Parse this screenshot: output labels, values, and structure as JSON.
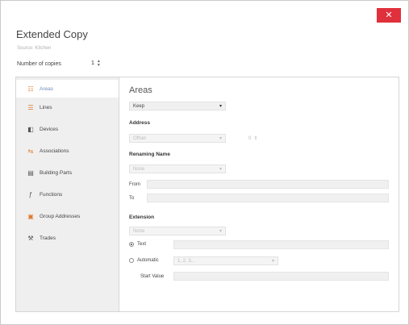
{
  "window": {
    "title": "Extended Copy",
    "subtitle": "Source: Kitchen",
    "close_label": "✕"
  },
  "copies": {
    "label": "Number of copies",
    "value": "1"
  },
  "nav": {
    "items": [
      {
        "label": "Areas",
        "icon": "areas-icon",
        "selected": true
      },
      {
        "label": "Lines",
        "icon": "lines-icon",
        "selected": false
      },
      {
        "label": "Devices",
        "icon": "devices-icon",
        "selected": false
      },
      {
        "label": "Associations",
        "icon": "associations-icon",
        "selected": false
      },
      {
        "label": "Building Parts",
        "icon": "building-parts-icon",
        "selected": false
      },
      {
        "label": "Functions",
        "icon": "functions-icon",
        "selected": false
      },
      {
        "label": "Group Addresses",
        "icon": "group-addresses-icon",
        "selected": false
      },
      {
        "label": "Trades",
        "icon": "trades-icon",
        "selected": false
      }
    ]
  },
  "areas": {
    "section_title": "Areas",
    "mode_value": "Keep",
    "address": {
      "label": "Address",
      "offset_value": "Offset",
      "offset_number": "0"
    },
    "renaming": {
      "label": "Renaming Name",
      "mode_value": "None",
      "from_label": "From",
      "from_value": "",
      "to_label": "To",
      "to_value": ""
    },
    "extension": {
      "label": "Extension",
      "mode_value": "None",
      "text_label": "Text",
      "text_value": "",
      "automatic_label": "Automatic",
      "automatic_value": "1, 2, 3...",
      "start_value_label": "Start Value",
      "start_value": ""
    }
  },
  "colors": {
    "close_button": "#e0303c",
    "nav_background": "#efefef",
    "accent_orange": "#e07a2e"
  }
}
